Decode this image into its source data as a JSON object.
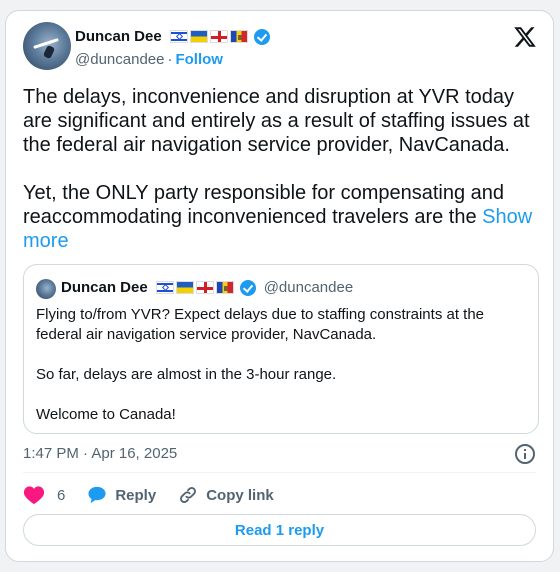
{
  "author": {
    "name": "Duncan Dee",
    "handle": "@duncandee",
    "separator": "·",
    "follow_label": "Follow",
    "verified": true,
    "flags": [
      "israel-flag",
      "ukraine-flag",
      "georgia-flag",
      "moldova-flag"
    ]
  },
  "tweet": {
    "paragraphs": [
      "The delays, inconvenience and disruption at YVR today are significant and entirely as a result of staffing issues at the federal air navigation service provider, NavCanada.",
      "Yet, the ONLY party responsible for compensating and reaccommodating inconvenienced travelers are the"
    ],
    "show_more": "Show more"
  },
  "quote": {
    "name": "Duncan Dee",
    "handle": "@duncandee",
    "paragraphs": [
      "Flying to/from YVR?  Expect delays due to staffing constraints at the federal air navigation service provider, NavCanada.",
      "So far, delays are almost in the 3-hour range.",
      "Welcome to Canada!"
    ]
  },
  "meta": {
    "timestamp": "1:47 PM · Apr 16, 2025"
  },
  "actions": {
    "like_count": "6",
    "reply_label": "Reply",
    "copy_link_label": "Copy link"
  },
  "read_reply_label": "Read 1 reply",
  "colors": {
    "accent": "#1d9bf0",
    "heart": "#f91880",
    "muted": "#536471"
  }
}
